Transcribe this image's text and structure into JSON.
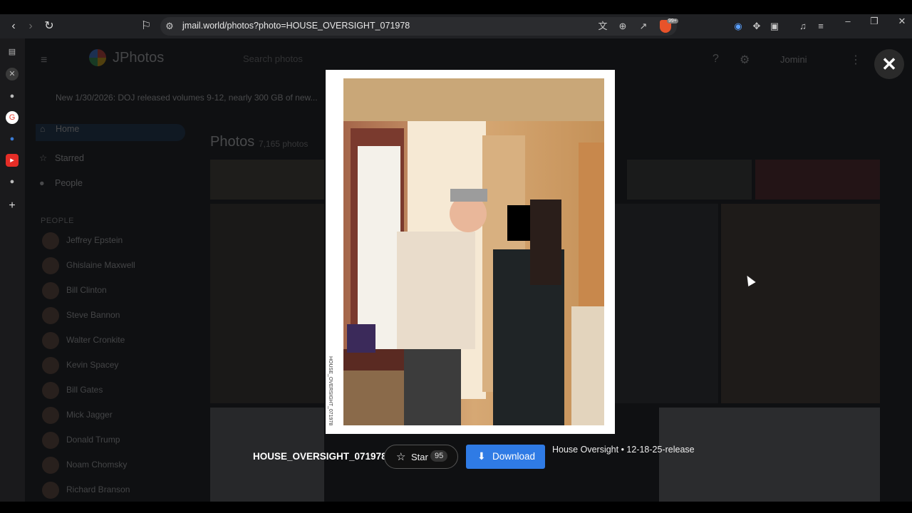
{
  "browser": {
    "url": "jmail.world/photos?photo=HOUSE_OVERSIGHT_071978",
    "extension_badge": "99+"
  },
  "app": {
    "name": "JPhotos",
    "search_placeholder": "Search photos",
    "assistant_label": "Jomini",
    "announcement": "New 1/30/2026: DOJ released volumes 9-12, nearly 300 GB of new..."
  },
  "nav": {
    "items": [
      {
        "label": "Home",
        "icon": "home-icon",
        "active": true
      },
      {
        "label": "Starred",
        "icon": "star-icon",
        "active": false
      },
      {
        "label": "People",
        "icon": "people-icon",
        "active": false
      }
    ],
    "people_header": "PEOPLE",
    "people": [
      "Jeffrey Epstein",
      "Ghislaine Maxwell",
      "Bill Clinton",
      "Steve Bannon",
      "Walter Cronkite",
      "Kevin Spacey",
      "Bill Gates",
      "Mick Jagger",
      "Donald Trump",
      "Noam Chomsky",
      "Richard Branson"
    ]
  },
  "gallery": {
    "title": "Photos",
    "count": "7,165 photos"
  },
  "lightbox": {
    "filename": "HOUSE_OVERSIGHT_071978",
    "side_caption": "HOUSE_OVERSIGHT_071978",
    "star_label": "Star",
    "star_count": "95",
    "download_label": "Download",
    "meta": "House Oversight • 12-18-25-release",
    "close_symbol": "✕"
  }
}
